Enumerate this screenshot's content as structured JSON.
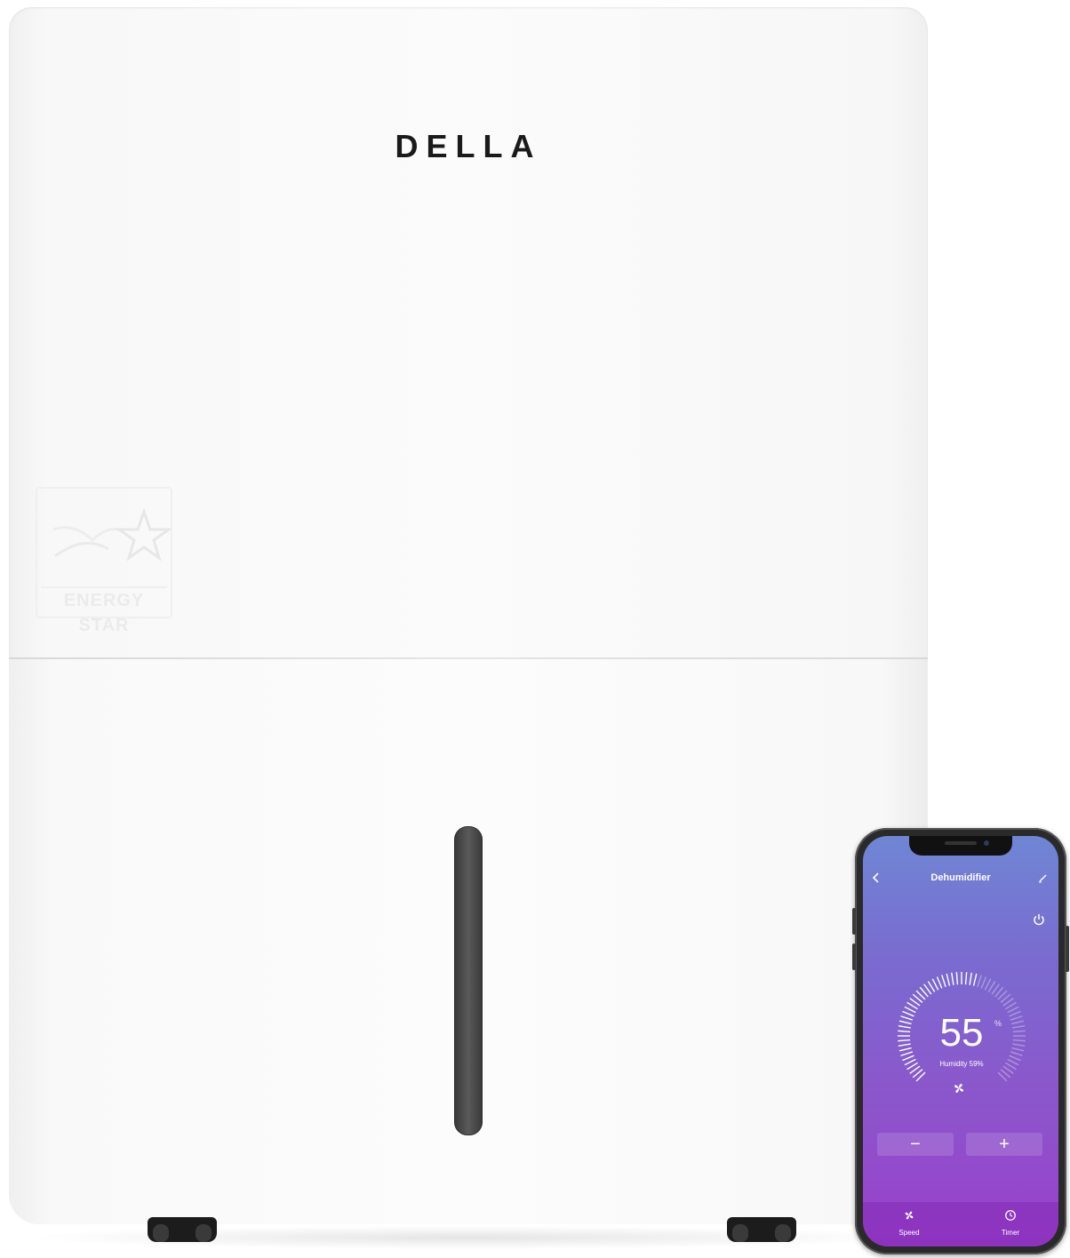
{
  "product": {
    "brand": "DELLA",
    "badge_text": "ENERGY STAR"
  },
  "app": {
    "title": "Dehumidifier",
    "target_humidity": "55",
    "target_unit": "%",
    "current_humidity": "Humidity 59%",
    "decrease_label": "−",
    "increase_label": "+",
    "tabs": [
      {
        "label": "Speed",
        "icon": "fan-icon"
      },
      {
        "label": "Timer",
        "icon": "clock-icon"
      }
    ]
  },
  "colors": {
    "screen_gradient_top": "#6f86d4",
    "screen_gradient_bottom": "#9a3fcc",
    "unit_body": "#fbfbfb",
    "water_window": "#4a4a4a"
  }
}
